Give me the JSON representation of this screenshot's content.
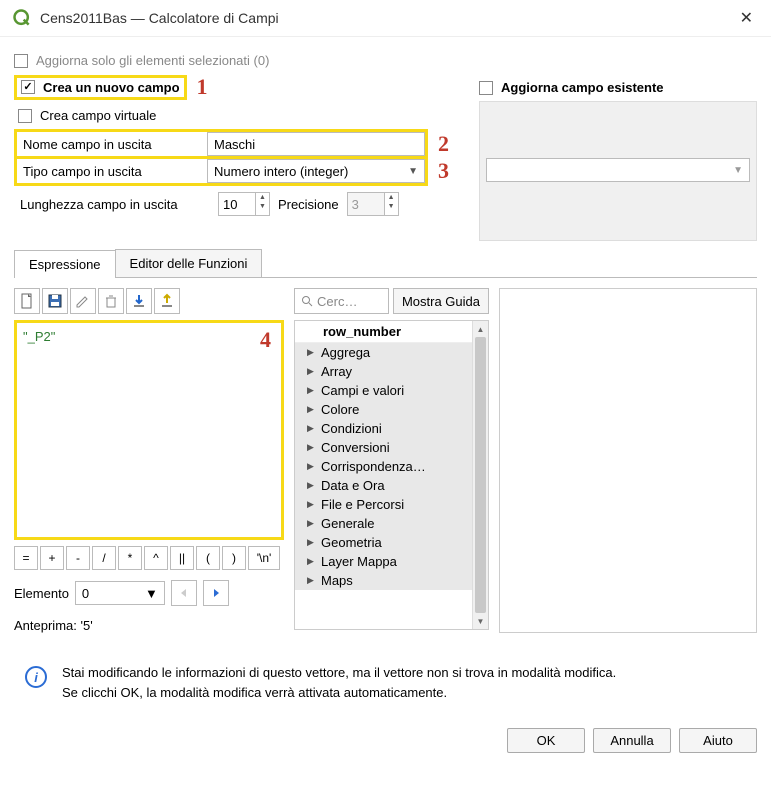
{
  "window": {
    "title": "Cens2011Bas — Calcolatore di Campi"
  },
  "topForm": {
    "updateSelectedLabel": "Aggiorna solo gli elementi selezionati (0)",
    "createNewFieldLabel": "Crea un nuovo campo",
    "createVirtualLabel": "Crea campo virtuale",
    "outFieldNameLabel": "Nome campo in uscita",
    "outFieldNameValue": "Maschi",
    "outFieldTypeLabel": "Tipo campo in uscita",
    "outFieldTypeValue": "Numero intero (integer)",
    "outFieldLenLabel": "Lunghezza campo in uscita",
    "outFieldLenValue": "10",
    "precisionLabel": "Precisione",
    "precisionValue": "3",
    "updateExistingLabel": "Aggiorna campo esistente"
  },
  "annotations": {
    "n1": "1",
    "n2": "2",
    "n3": "3",
    "n4": "4"
  },
  "tabs": {
    "expression": "Espressione",
    "funcEditor": "Editor delle Funzioni"
  },
  "expression": {
    "text": "\"_P2\"",
    "elementLabel": "Elemento",
    "elementValue": "0",
    "previewLabel": "Anteprima:",
    "previewValue": "'5'"
  },
  "operators": [
    "=",
    "+",
    "-",
    "/",
    "*",
    "^",
    "||",
    "(",
    ")",
    "'\\n'"
  ],
  "search": {
    "placeholder": "Cerc…",
    "helpLabel": "Mostra Guida"
  },
  "funcList": {
    "header": "row_number",
    "items": [
      "Aggrega",
      "Array",
      "Campi e valori",
      "Colore",
      "Condizioni",
      "Conversioni",
      "Corrispondenza…",
      "Data e Ora",
      "File e Percorsi",
      "Generale",
      "Geometria",
      "Layer Mappa",
      "Maps"
    ]
  },
  "info": {
    "line1": "Stai modificando le informazioni di questo vettore, ma il vettore non si trova in modalità modifica.",
    "line2": "Se clicchi OK, la modalità modifica verrà attivata automaticamente."
  },
  "buttons": {
    "ok": "OK",
    "cancel": "Annulla",
    "help": "Aiuto"
  }
}
